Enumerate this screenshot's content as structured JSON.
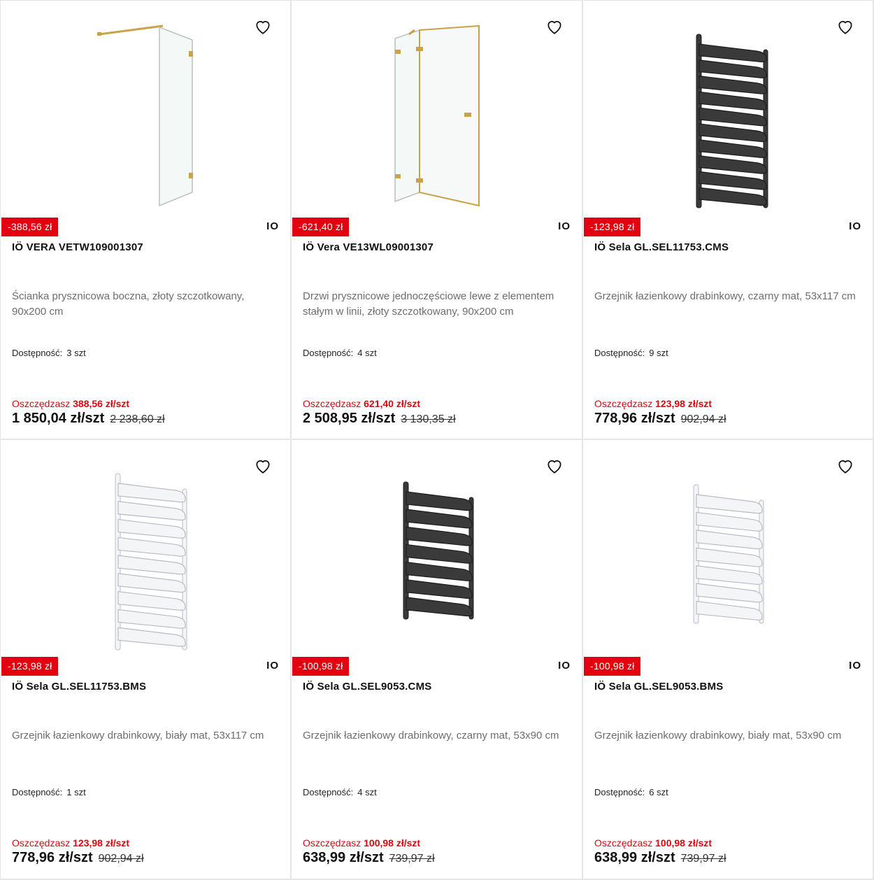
{
  "products": [
    {
      "badge": "-388,56 zł",
      "brand": "IO",
      "title": "IÖ VERA VETW109001307",
      "desc": "Ścianka prysznicowa boczna, złoty szczotkowany, 90x200 cm",
      "avail_label": "Dostępność:",
      "avail_value": "3 szt",
      "save_label": "Oszczędzasz",
      "save_amount": "388,56 zł/szt",
      "price": "1 850,04 zł/szt",
      "old_price": "2 238,60 zł",
      "image": "shower-wall-gold"
    },
    {
      "badge": "-621,40 zł",
      "brand": "IO",
      "title": "IÖ Vera VE13WL09001307",
      "desc": "Drzwi prysznicowe jednoczęściowe lewe z elementem stałym w linii, złoty szczotkowany, 90x200 cm",
      "avail_label": "Dostępność:",
      "avail_value": "4 szt",
      "save_label": "Oszczędzasz",
      "save_amount": "621,40 zł/szt",
      "price": "2 508,95 zł/szt",
      "old_price": "3 130,35 zł",
      "image": "shower-door-gold"
    },
    {
      "badge": "-123,98 zł",
      "brand": "IO",
      "title": "IÖ Sela GL.SEL11753.CMS",
      "desc": "Grzejnik łazienkowy drabinkowy, czarny mat, 53x117 cm",
      "avail_label": "Dostępność:",
      "avail_value": "9 szt",
      "save_label": "Oszczędzasz",
      "save_amount": "123,98 zł/szt",
      "price": "778,96 zł/szt",
      "old_price": "902,94 zł",
      "image": "radiator-black-tall"
    },
    {
      "badge": "-123,98 zł",
      "brand": "IO",
      "title": "IÖ Sela GL.SEL11753.BMS",
      "desc": "Grzejnik łazienkowy drabinkowy, biały mat, 53x117 cm",
      "avail_label": "Dostępność:",
      "avail_value": "1 szt",
      "save_label": "Oszczędzasz",
      "save_amount": "123,98 zł/szt",
      "price": "778,96 zł/szt",
      "old_price": "902,94 zł",
      "image": "radiator-white-tall"
    },
    {
      "badge": "-100,98 zł",
      "brand": "IO",
      "title": "IÖ Sela GL.SEL9053.CMS",
      "desc": "Grzejnik łazienkowy drabinkowy, czarny mat, 53x90 cm",
      "avail_label": "Dostępność:",
      "avail_value": "4 szt",
      "save_label": "Oszczędzasz",
      "save_amount": "100,98 zł/szt",
      "price": "638,99 zł/szt",
      "old_price": "739,97 zł",
      "image": "radiator-black-short"
    },
    {
      "badge": "-100,98 zł",
      "brand": "IO",
      "title": "IÖ Sela GL.SEL9053.BMS",
      "desc": "Grzejnik łazienkowy drabinkowy, biały mat, 53x90 cm",
      "avail_label": "Dostępność:",
      "avail_value": "6 szt",
      "save_label": "Oszczędzasz",
      "save_amount": "100,98 zł/szt",
      "price": "638,99 zł/szt",
      "old_price": "739,97 zł",
      "image": "radiator-white-short"
    }
  ],
  "colors": {
    "accent_red": "#e3000f",
    "gold": "#c9a24a",
    "black_mat": "#3a3a3a",
    "white_mat": "#f2f3f5"
  }
}
